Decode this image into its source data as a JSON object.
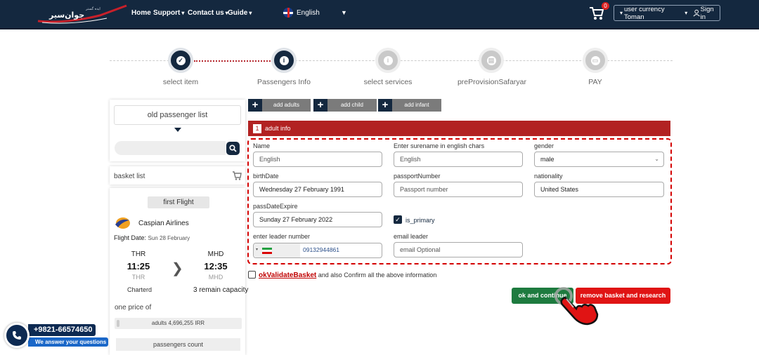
{
  "header": {
    "logo_text": "جوان سیر ایده‌گستر",
    "nav": [
      {
        "label": "Home"
      },
      {
        "label": "Support"
      },
      {
        "label": "Contact us"
      },
      {
        "label": "Guide"
      }
    ],
    "language": "English",
    "cart_count": "0",
    "currency_label": "user currency Toman",
    "sign_in": "Sign in"
  },
  "steps": [
    {
      "label": "select item",
      "state": "done"
    },
    {
      "label": "Passengers Info",
      "state": "current"
    },
    {
      "label": "select services",
      "state": "todo"
    },
    {
      "label": "preProvisionSafaryar",
      "state": "todo"
    },
    {
      "label": "PAY",
      "state": "todo"
    }
  ],
  "sidebar": {
    "old_passenger_list": "old passenger list",
    "basket_list": "basket list",
    "flight_tag": "first Flight",
    "airline": "Caspian Airlines",
    "flight_date_label": "Flight Date:",
    "flight_date": "Sun 28 February",
    "origin_code": "THR",
    "origin_time": "11:25",
    "origin_sub": "THR",
    "dest_code": "MHD",
    "dest_time": "12:35",
    "dest_sub": "MHD",
    "flight_type": "Charterd",
    "capacity": "3 remain capacity",
    "one_price": "one price of",
    "price_line": "adults 4,696,255 IRR",
    "passengers_count": "passengers count"
  },
  "add_buttons": {
    "adults": "add adults",
    "child": "add child",
    "infant": "add infant"
  },
  "adult": {
    "index": "1",
    "header": "adult info",
    "name_label": "Name",
    "name_placeholder": "English",
    "surname_label": "Enter surename in english chars",
    "surname_placeholder": "English",
    "gender_label": "gender",
    "gender_value": "male",
    "birth_label": "birthDate",
    "birth_value": "Wednesday 27 February 1991",
    "passport_label": "passportNumber",
    "passport_placeholder": "Passport number",
    "nationality_label": "nationality",
    "nationality_value": "United States",
    "expire_label": "passDateExpire",
    "expire_value": "Sunday 27 February 2022",
    "is_primary_label": "is_primary",
    "leader_number_label": "enter leader number",
    "leader_number": "09132944861",
    "email_label": "email leader",
    "email_placeholder": "email Optional"
  },
  "agree": {
    "link": "okValidateBasket",
    "text": "and also Confirm all the above information"
  },
  "buttons": {
    "ok": "ok and continue",
    "remove": "remove basket and research"
  },
  "contact_widget": {
    "phone": "+9821-66574650",
    "sub": "We answer your questions"
  },
  "colors": {
    "header_bg": "#14283f",
    "accent_red": "#b22222",
    "ok_green": "#1e7b3f",
    "remove_red": "#e01414"
  }
}
